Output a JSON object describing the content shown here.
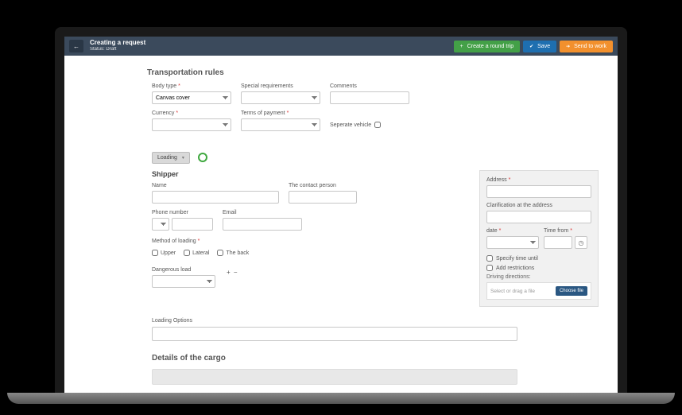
{
  "header": {
    "title": "Creating a request",
    "status_label": "Status:",
    "status_value": "Draft",
    "round_trip": "Create a round trip",
    "save": "Save",
    "send": "Send to work"
  },
  "transport": {
    "title": "Transportation rules",
    "body_type_label": "Body type",
    "body_type_value": "Canvas cover",
    "special_label": "Special requirements",
    "comments_label": "Comments",
    "currency_label": "Currency",
    "terms_label": "Terms of payment",
    "separate_vehicle_label": "Seperate vehicle"
  },
  "loading": {
    "pill": "Loading"
  },
  "shipper": {
    "title": "Shipper",
    "name_label": "Name",
    "contact_label": "The contact person",
    "phone_label": "Phone number",
    "email_label": "Email",
    "method_label": "Method of loading",
    "upper": "Upper",
    "lateral": "Lateral",
    "back": "The back",
    "dangerous_label": "Dangerous load"
  },
  "address": {
    "address_label": "Address",
    "clarification_label": "Clarification at the address",
    "date_label": "date",
    "time_from_label": "Time from",
    "specify_until": "Specify time until",
    "add_restrictions": "Add restrictions",
    "directions_label": "Driving directions:",
    "drop_placeholder": "Select or drag a file",
    "choose_file": "Choose file"
  },
  "options": {
    "title": "Loading Options"
  },
  "cargo": {
    "title": "Details of the cargo"
  }
}
